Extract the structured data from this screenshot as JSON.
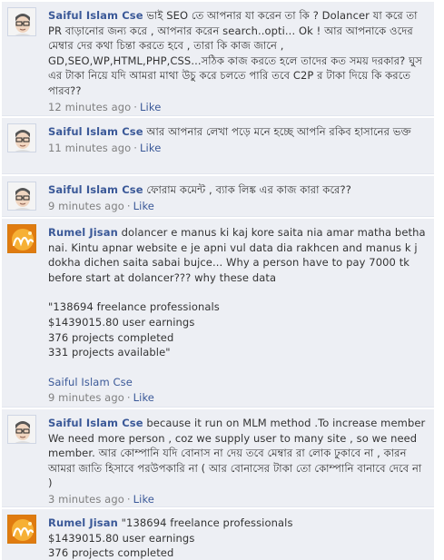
{
  "comments": [
    {
      "author": "Saiful Islam Cse",
      "text": "ভাই SEO তে আপনার যা করেন তা কি ? Dolancer যা করে তা PR বাড়ানোর জন্য করে , আপনার করেন search..opti... Ok ! আর আপনাকে ওদের মেম্বার দের কথা চিন্তা করতে হবে , তারা কি কাজ জানে , GD,SEO,WP,HTML,PHP,CSS...সঠিক কাজ করতে হলে তাদের কত সময় দরকার? ঘুস এর টাকা নিয়ে যদি আমরা মাথা উচু করে চলতে পারি তবে C2P র টাকা দিয়ে কি করতে পারব??",
      "time": "12 minutes ago",
      "like": "Like"
    },
    {
      "author": "Saiful Islam Cse",
      "text": "আর আপনার লেখা পড়ে মনে হচ্ছে আপনি রকিব হাসানের ভক্ত",
      "time": "11 minutes ago",
      "like": "Like"
    },
    {
      "author": "Saiful Islam Cse",
      "text": "ফোরাম কমেন্ট , ব্যাক লিঙ্ক এর কাজ কারা করে??",
      "time": "9 minutes ago",
      "like": "Like"
    },
    {
      "author": "Rumel Jisan",
      "text": "dolancer e manus ki kaj kore saita nia amar matha betha nai. Kintu apnar website e je apni vul data dia rakhcen and manus k j dokha dichen saita sabai bujce... Why a person have to pay 7000 tk before start at dolancer??? why these data",
      "quote": "\"138694 freelance professionals\n$1439015.80 user earnings\n376 projects completed\n331 projects available\"",
      "mention": "Saiful Islam Cse",
      "time": "9 minutes ago",
      "like": "Like"
    },
    {
      "author": "Saiful Islam Cse",
      "text": "because it run on MLM method .To increase member We need more person , coz we supply user to many site , so we need member. আর কোম্পানি যদি বোনাস না দেয় তবে মেম্বার রা লোক ঢুকাবে না , কারন আমরা জাতি হিসাবে পরউপকারি না ( আর বোনাসের টাকা তো কোম্পানি বানাবে দেবে না )",
      "time": "3 minutes ago",
      "like": "Like"
    },
    {
      "author": "Rumel Jisan",
      "text": "\"138694 freelance professionals\n$1439015.80 user earnings\n376 projects completed"
    }
  ],
  "separator": "·",
  "colors": {
    "link": "#3b5998",
    "background": "#edeff4",
    "meta": "#7f7f7f"
  }
}
